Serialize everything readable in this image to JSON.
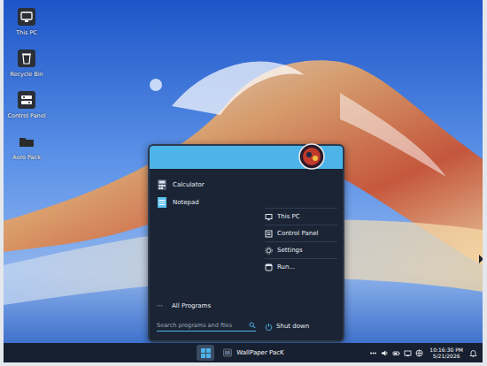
{
  "desktop_icons": [
    {
      "label": "This PC"
    },
    {
      "label": "Recycle Bin"
    },
    {
      "label": "Control Panel"
    },
    {
      "label": "Aero Pack"
    }
  ],
  "start_menu": {
    "programs": [
      {
        "label": "Calculator"
      },
      {
        "label": "Notepad"
      }
    ],
    "all_programs": {
      "icon": "⋯",
      "label": "All Programs"
    },
    "search": {
      "placeholder": "Search programs and files"
    },
    "links": [
      {
        "label": "This PC"
      },
      {
        "label": "Control Panel"
      },
      {
        "label": "Settings"
      },
      {
        "label": "Run..."
      }
    ],
    "shutdown": "Shut down"
  },
  "taskbar": {
    "start_selected": true,
    "tasks": [
      {
        "label": "WallPaper PacK",
        "selected": false
      }
    ],
    "clock": {
      "time": "10:16:30 PM",
      "date": "5/21/2026"
    }
  }
}
